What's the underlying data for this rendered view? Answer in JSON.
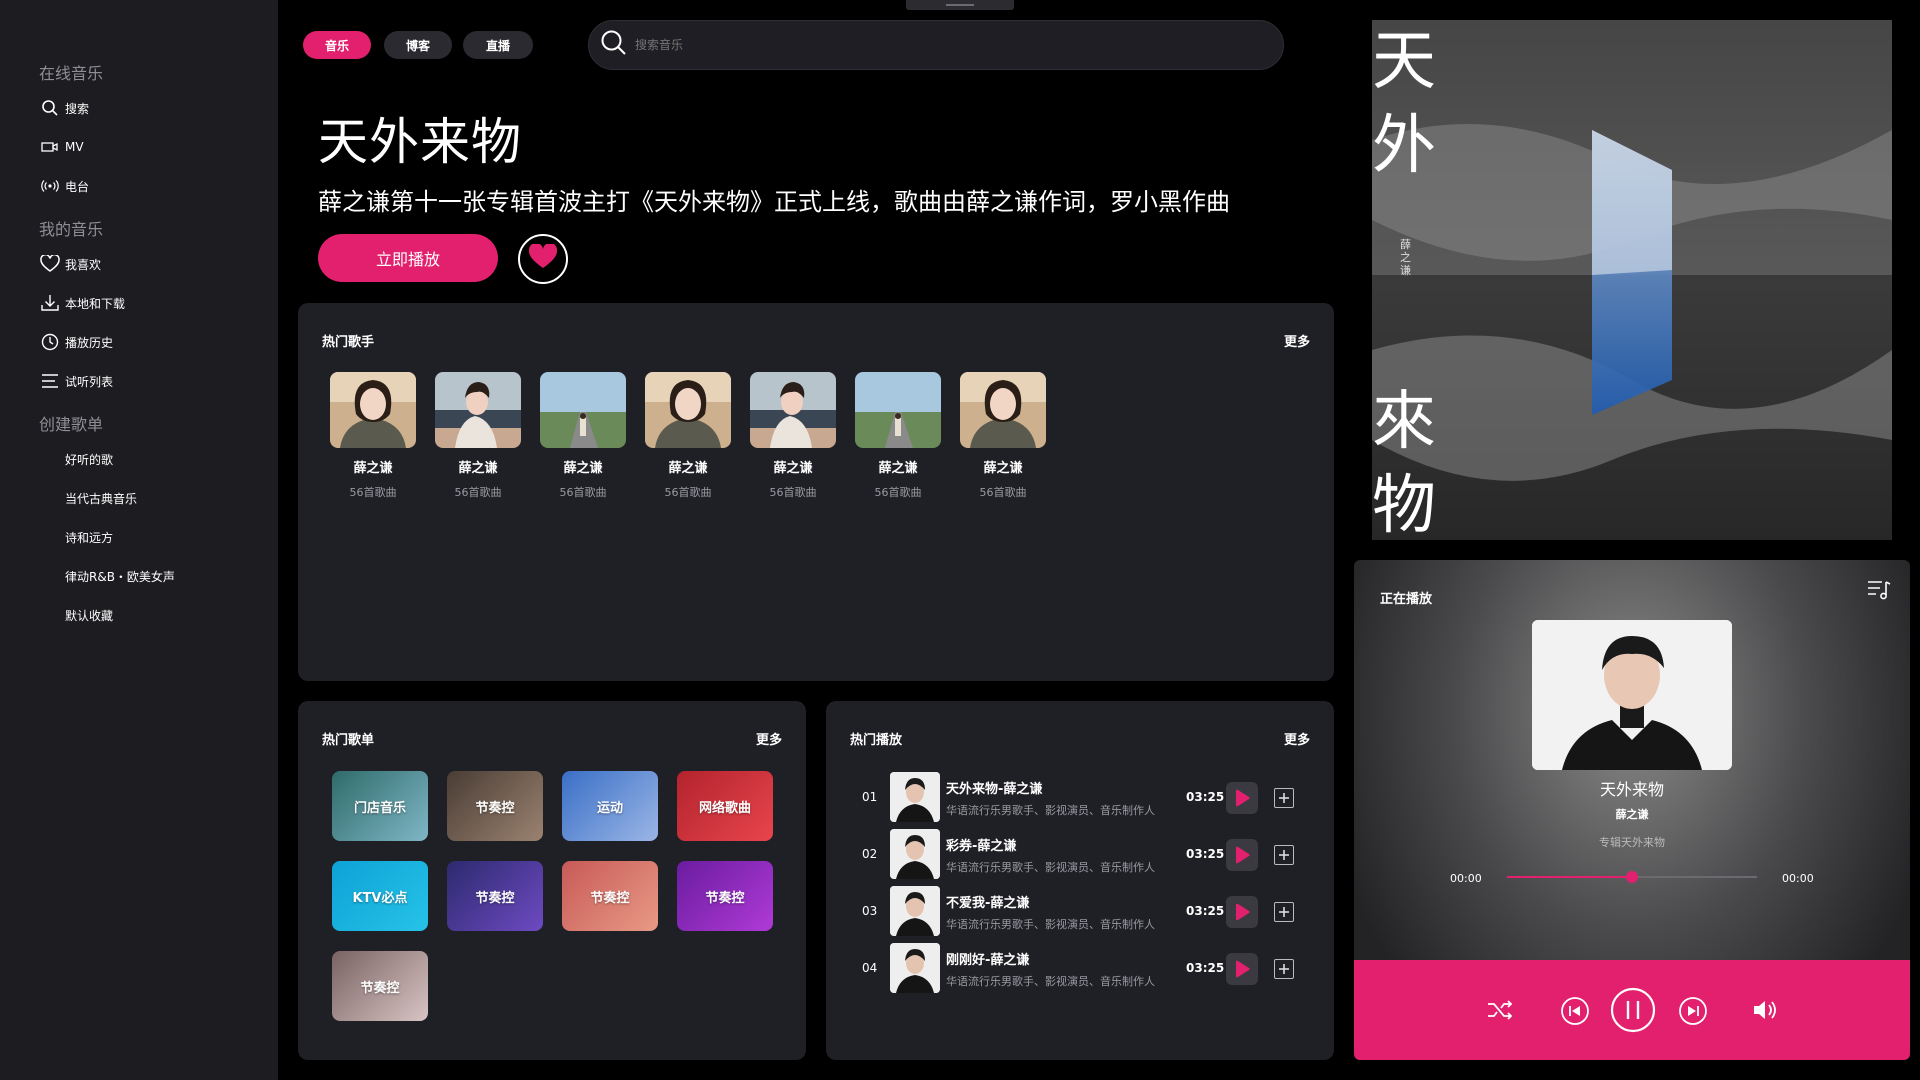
{
  "sidebar": {
    "sections": [
      {
        "title": "在线音乐"
      },
      {
        "title": "我的音乐"
      },
      {
        "title": "创建歌单"
      }
    ],
    "online": [
      {
        "label": "搜索",
        "icon": "search-icon"
      },
      {
        "label": "MV",
        "icon": "video-icon"
      },
      {
        "label": "电台",
        "icon": "radio-icon"
      }
    ],
    "mine": [
      {
        "label": "我喜欢",
        "icon": "heart-icon"
      },
      {
        "label": "本地和下载",
        "icon": "download-icon"
      },
      {
        "label": "播放历史",
        "icon": "clock-icon"
      },
      {
        "label": "试听列表",
        "icon": "list-icon"
      }
    ],
    "playlists": [
      "好听的歌",
      "当代古典音乐",
      "诗和远方",
      "律动R&B・欧美女声",
      "默认收藏"
    ]
  },
  "tabs": [
    {
      "label": "音乐",
      "active": true
    },
    {
      "label": "博客",
      "active": false
    },
    {
      "label": "直播",
      "active": false
    }
  ],
  "search": {
    "placeholder": "搜索音乐"
  },
  "hero": {
    "title": "天外来物",
    "subtitle": "薛之谦第十一张专辑首波主打《天外来物》正式上线，歌曲由薛之谦作词，罗小黑作曲",
    "play_label": "立即播放"
  },
  "hot_singers": {
    "title": "热门歌手",
    "more": "更多",
    "items": [
      {
        "name": "薛之谦",
        "count": "56首歌曲",
        "photo": "portrait"
      },
      {
        "name": "薛之谦",
        "count": "56首歌曲",
        "photo": "sea"
      },
      {
        "name": "薛之谦",
        "count": "56首歌曲",
        "photo": "road"
      },
      {
        "name": "薛之谦",
        "count": "56首歌曲",
        "photo": "portrait"
      },
      {
        "name": "薛之谦",
        "count": "56首歌曲",
        "photo": "sea"
      },
      {
        "name": "薛之谦",
        "count": "56首歌曲",
        "photo": "road"
      },
      {
        "name": "薛之谦",
        "count": "56首歌曲",
        "photo": "portrait"
      }
    ]
  },
  "hot_playlists": {
    "title": "热门歌单",
    "more": "更多",
    "items": [
      {
        "label": "门店音乐",
        "colors": [
          "#2f6b6a",
          "#7fb6c6"
        ]
      },
      {
        "label": "节奏控",
        "colors": [
          "#4a3d35",
          "#9a8270"
        ]
      },
      {
        "label": "运动",
        "colors": [
          "#3a6fc6",
          "#9bb6e6"
        ]
      },
      {
        "label": "网络歌曲",
        "colors": [
          "#b3232d",
          "#e8454d"
        ]
      },
      {
        "label": "KTV必点",
        "colors": [
          "#0ea2d8",
          "#26c3e6"
        ]
      },
      {
        "label": "节奏控",
        "colors": [
          "#2c2a6e",
          "#6e4ac2"
        ]
      },
      {
        "label": "节奏控",
        "colors": [
          "#c85a57",
          "#e89a86"
        ]
      },
      {
        "label": "节奏控",
        "colors": [
          "#6a1ca0",
          "#b03ad6"
        ]
      },
      {
        "label": "节奏控",
        "colors": [
          "#7a6262",
          "#d8c4c4"
        ]
      }
    ]
  },
  "hot_plays": {
    "title": "热门播放",
    "more": "更多",
    "items": [
      {
        "no": "01",
        "title": "天外来物-薛之谦",
        "desc": "华语流行乐男歌手、影视演员、音乐制作人",
        "duration": "03:25"
      },
      {
        "no": "02",
        "title": "彩券-薛之谦",
        "desc": "华语流行乐男歌手、影视演员、音乐制作人",
        "duration": "03:25"
      },
      {
        "no": "03",
        "title": "不爱我-薛之谦",
        "desc": "华语流行乐男歌手、影视演员、音乐制作人",
        "duration": "03:25"
      },
      {
        "no": "04",
        "title": "刚刚好-薛之谦",
        "desc": "华语流行乐男歌手、影视演员、音乐制作人",
        "duration": "03:25"
      }
    ]
  },
  "album_art": {
    "text_top": "天外",
    "text_bottom": "來物",
    "vertical": "薛之谦"
  },
  "now_playing": {
    "label": "正在播放",
    "song": "天外来物",
    "artist": "薛之谦",
    "album": "专辑天外来物",
    "current_time": "00:00",
    "total_time": "00:00",
    "progress": 0.5
  },
  "colors": {
    "accent": "#e2206e",
    "panel": "#1f1f26",
    "sidebar": "#1c1c21"
  }
}
